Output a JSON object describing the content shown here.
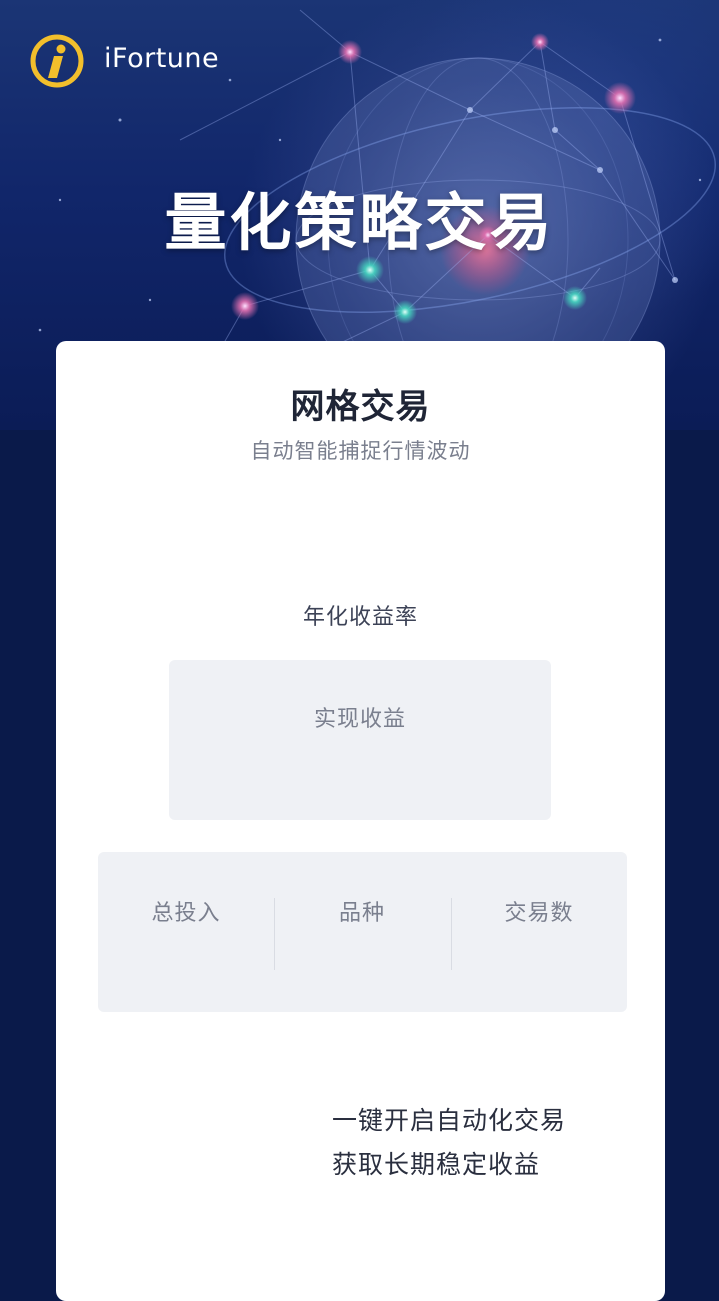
{
  "app": {
    "brand_name": "iFortune"
  },
  "hero": {
    "title": "量化策略交易"
  },
  "card": {
    "title": "网格交易",
    "subtitle": "自动智能捕捉行情波动",
    "metric_label": "年化收益率",
    "profit_label": "实现收益",
    "stats": [
      {
        "label": "总投入"
      },
      {
        "label": "品种"
      },
      {
        "label": "交易数"
      }
    ],
    "promo_lines": [
      "一键开启自动化交易",
      "获取长期稳定收益"
    ]
  },
  "colors": {
    "background": "#0a1a4a",
    "card": "#ffffff",
    "panel": "#eff1f5",
    "logo_gold": "#f2bf2c"
  }
}
